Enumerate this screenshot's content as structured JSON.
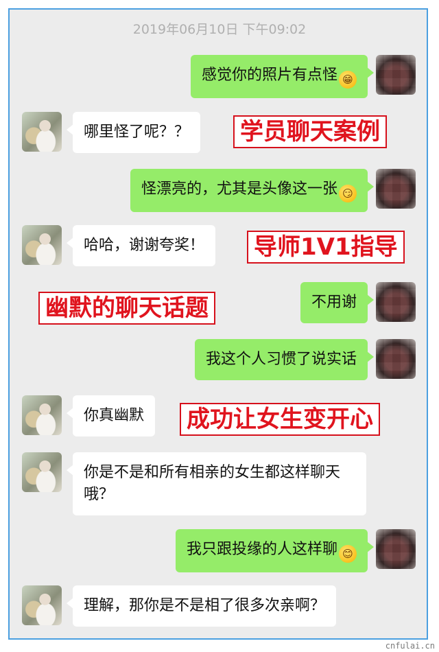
{
  "chat": {
    "timestamp": "2019年06月10日 下午09:02",
    "messages": [
      {
        "from": "me",
        "text": "感觉你的照片有点怪",
        "emoji": "grin-emoji"
      },
      {
        "from": "them",
        "text": "哪里怪了呢？？"
      },
      {
        "from": "me",
        "text": "怪漂亮的，尤其是头像这一张",
        "emoji": "smirk-emoji"
      },
      {
        "from": "them",
        "text": "哈哈，谢谢夸奖！"
      },
      {
        "from": "me",
        "text": "不用谢"
      },
      {
        "from": "me",
        "text": "我这个人习惯了说实话"
      },
      {
        "from": "them",
        "text": "你真幽默"
      },
      {
        "from": "them",
        "text": "你是不是和所有相亲的女生都这样聊天哦？"
      },
      {
        "from": "me",
        "text": "我只跟投缘的人这样聊",
        "emoji": "smile-emoji"
      },
      {
        "from": "them",
        "text": "理解，那你是不是相了很多次亲啊？"
      }
    ]
  },
  "overlays": {
    "stamp_1": "学员聊天案例",
    "stamp_2": "导师1V1指导",
    "stamp_3": "幽默的聊天话题",
    "stamp_4": "成功让女生变开心"
  },
  "watermark": "cnfulai.cn",
  "colors": {
    "frame_border": "#4a9fe0",
    "chat_background": "#ececec",
    "my_bubble": "#95ec69",
    "their_bubble": "#ffffff",
    "stamp_red": "#e0141e"
  }
}
